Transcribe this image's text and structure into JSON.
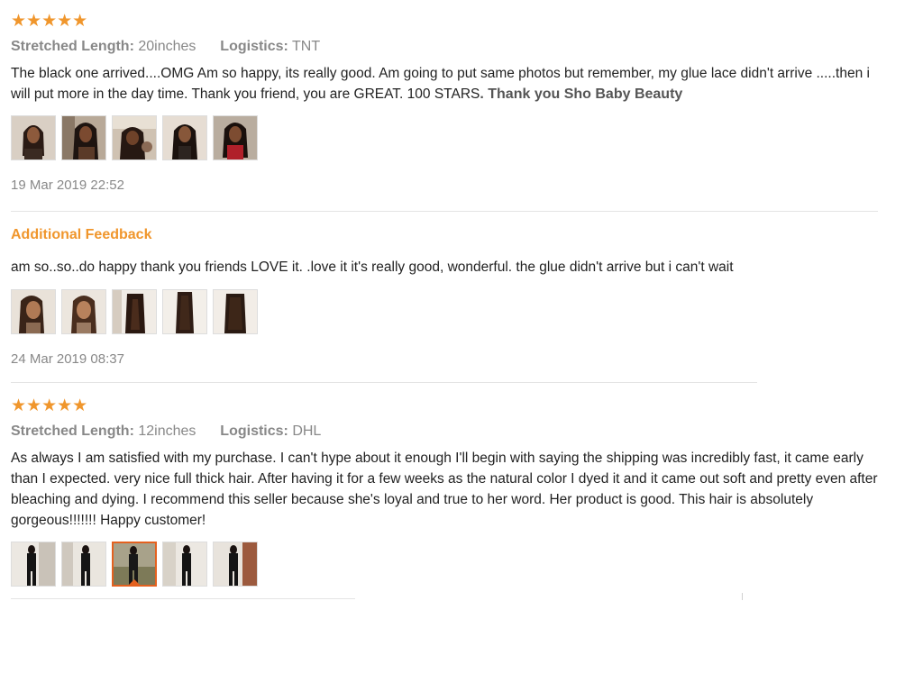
{
  "reviews": [
    {
      "stars": "★★★★★",
      "stretched_length_label": "Stretched Length:",
      "stretched_length_value": "20inches",
      "logistics_label": "Logistics:",
      "logistics_value": "TNT",
      "text": "The black one arrived....OMG Am so happy, its really good. Am going to put same photos but remember, my glue lace didn't arrive .....then i will put more in the day time. Thank you friend, you are GREAT. 100 STARS",
      "signature": ". Thank you Sho Baby Beauty",
      "date": "19 Mar 2019 22:52",
      "additional_feedback": {
        "title": "Additional Feedback",
        "text": "am so..so..do happy thank you friends LOVE it. .love it it's really good, wonderful. the glue didn't arrive but i can't wait",
        "date": "24 Mar 2019 08:37"
      }
    },
    {
      "stars": "★★★★★",
      "stretched_length_label": "Stretched Length:",
      "stretched_length_value": "12inches",
      "logistics_label": "Logistics:",
      "logistics_value": "DHL",
      "text": "As always I am satisfied with my purchase. I can't hype about it enough I'll begin with saying the shipping was incredibly fast, it came early than I expected. very nice full thick hair. After having it for a few weeks as the natural color I dyed it and it came out soft and pretty even after bleaching and dying. I recommend this seller because she's loyal and true to her word. Her product is good. This hair is absolutely gorgeous!!!!!!! Happy customer!"
    }
  ],
  "colors": {
    "star": "#f0962c",
    "accent": "#e4611f",
    "muted": "#888888"
  }
}
